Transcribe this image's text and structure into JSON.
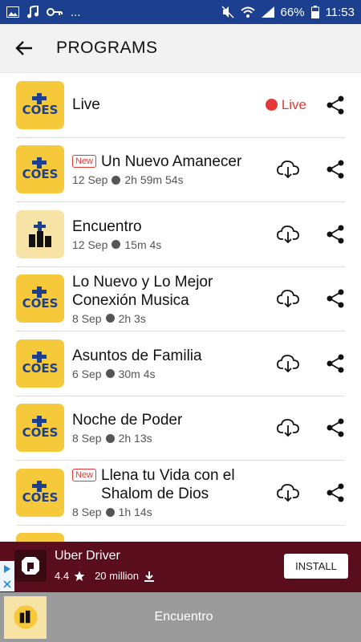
{
  "status_bar": {
    "icons": [
      "image-icon",
      "music-icon",
      "key-icon",
      "more-dots-icon"
    ],
    "more": "...",
    "battery": "66%",
    "time": "11:53"
  },
  "app_bar": {
    "title": "PROGRAMS"
  },
  "live_label": "Live",
  "programs": [
    {
      "title": "Live",
      "is_live": true
    },
    {
      "title": "Un Nuevo Amanecer",
      "new": "New",
      "date": "12 Sep",
      "duration": "2h 59m 54s"
    },
    {
      "title": "Encuentro",
      "date": "12 Sep",
      "duration": "15m 4s",
      "thumb": "light"
    },
    {
      "title": "Lo Nuevo y Lo Mejor Conexión Musica",
      "date": "8 Sep",
      "duration": "2h 3s"
    },
    {
      "title": "Asuntos de Familia",
      "date": "6 Sep",
      "duration": "30m 4s"
    },
    {
      "title": "Noche de Poder",
      "date": "8 Sep",
      "duration": "2h 13s"
    },
    {
      "title": "Llena tu Vida con el Shalom de Dios",
      "new": "New",
      "date": "8 Sep",
      "duration": "1h 14s"
    }
  ],
  "ad": {
    "app_name": "Uber Driver",
    "rating": "4.4",
    "downloads": "20 million",
    "install": "INSTALL"
  },
  "player": {
    "title": "Encuentro"
  },
  "colors": {
    "status_bar": "#1c3f8f",
    "live_red": "#e53935",
    "ad_bg": "#5a0d1c",
    "player_bg": "#9b9b9b"
  }
}
